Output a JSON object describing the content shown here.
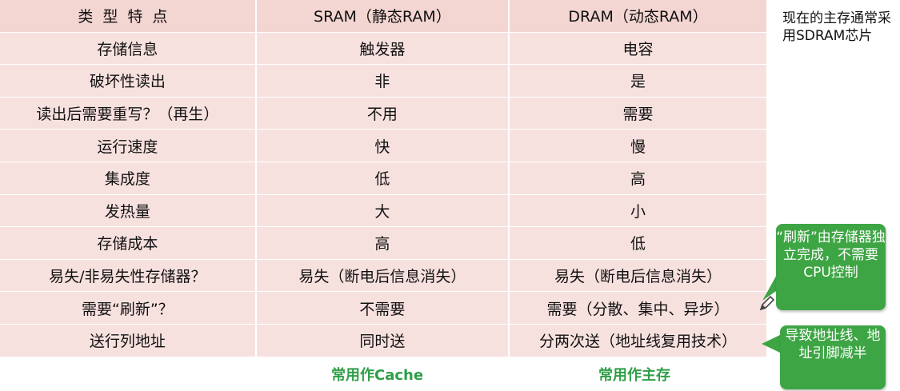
{
  "table": {
    "header": {
      "type": "类型特点",
      "sram": "SRAM（静态RAM）",
      "dram": "DRAM（动态RAM）"
    },
    "rows": [
      {
        "feature": "存储信息",
        "sram": "触发器",
        "dram": "电容"
      },
      {
        "feature": "破坏性读出",
        "sram": "非",
        "dram": "是"
      },
      {
        "feature": "读出后需要重写？（再生）",
        "sram": "不用",
        "dram": "需要"
      },
      {
        "feature": "运行速度",
        "sram": "快",
        "dram": "慢"
      },
      {
        "feature": "集成度",
        "sram": "低",
        "dram": "高"
      },
      {
        "feature": "发热量",
        "sram": "大",
        "dram": "小"
      },
      {
        "feature": "存储成本",
        "sram": "高",
        "dram": "低"
      },
      {
        "feature": "易失/非易失性存储器？",
        "sram": "易失（断电后信息消失）",
        "dram": "易失（断电后信息消失）"
      },
      {
        "feature": "需要“刷新”？",
        "sram": "不需要",
        "dram": "需要（分散、集中、异步）"
      },
      {
        "feature": "送行列地址",
        "sram": "同时送",
        "dram": "分两次送（地址线复用技术）"
      }
    ]
  },
  "footer": {
    "sram_use": "常用作Cache",
    "dram_use": "常用作主存"
  },
  "side_note": "现在的主存通常采用SDRAM芯片",
  "callouts": {
    "refresh": "“刷新”由存储器独立完成，不需要CPU控制",
    "address": "导致地址线、地址引脚减半"
  },
  "colors": {
    "table_bg": "#f7e1df",
    "header_bg": "#f3d5d1",
    "footer_text": "#2f9e47",
    "callout_bg": "#3ea544"
  },
  "icons": {
    "pen": "pencil-icon"
  }
}
